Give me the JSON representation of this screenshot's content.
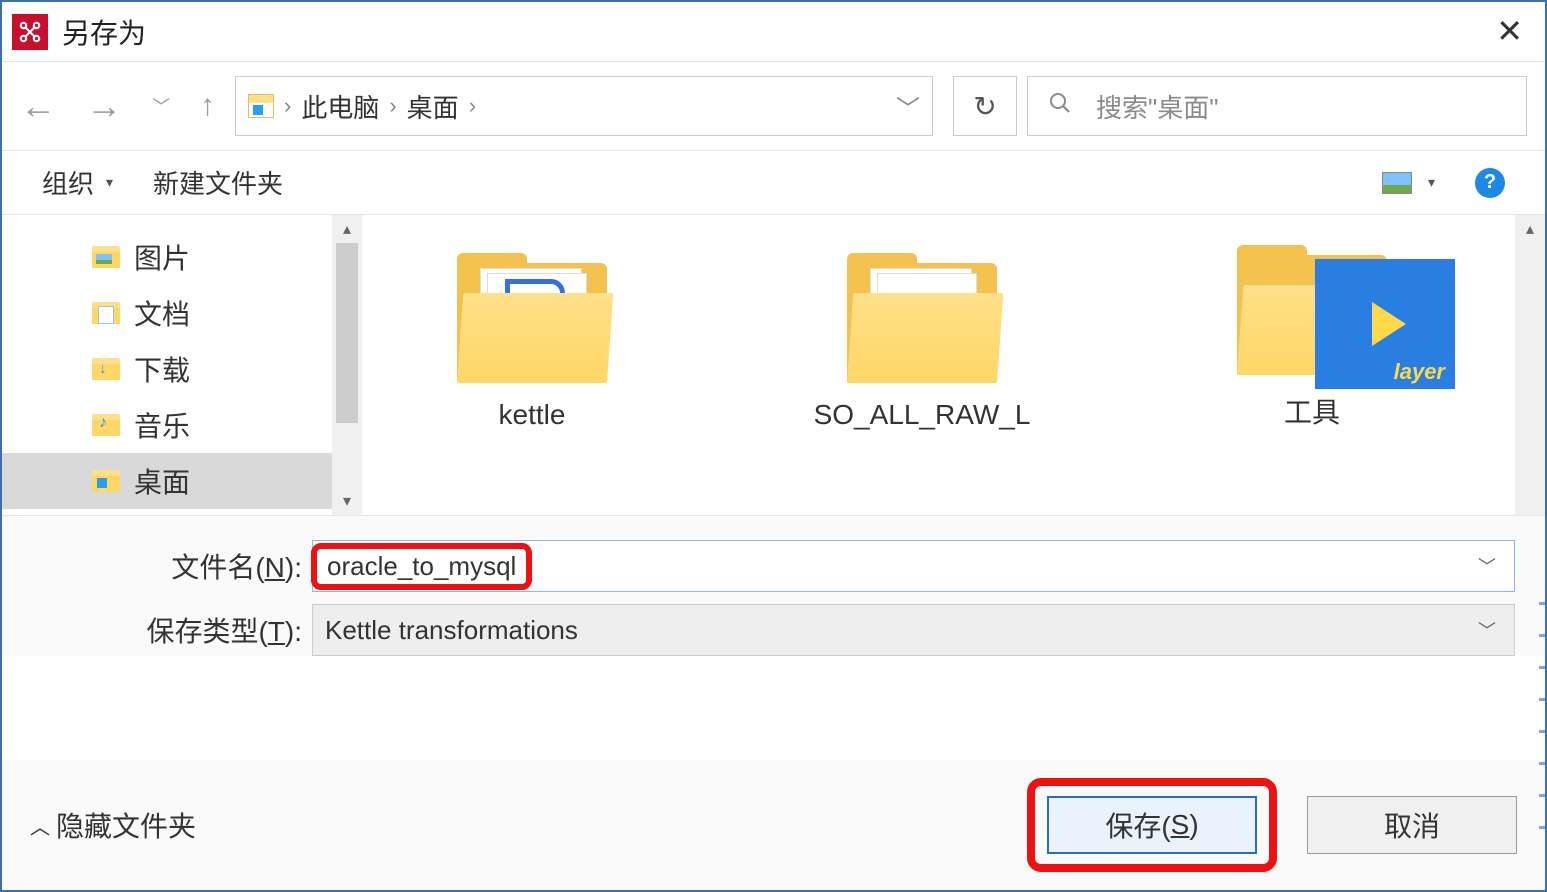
{
  "titlebar": {
    "title": "另存为"
  },
  "nav": {
    "breadcrumb": [
      "此电脑",
      "桌面"
    ],
    "search_placeholder": "搜索\"桌面\""
  },
  "toolbar": {
    "organize": "组织",
    "new_folder": "新建文件夹"
  },
  "sidebar": {
    "items": [
      {
        "label": "图片",
        "icon": "pic"
      },
      {
        "label": "文档",
        "icon": "doc"
      },
      {
        "label": "下载",
        "icon": "dl"
      },
      {
        "label": "音乐",
        "icon": "music"
      },
      {
        "label": "桌面",
        "icon": "desktop",
        "selected": true
      }
    ]
  },
  "content": {
    "items": [
      {
        "label": "kettle",
        "kind": "folder-doc"
      },
      {
        "label": "SO_ALL_RAW_L",
        "kind": "folder-text"
      },
      {
        "label": "工具",
        "kind": "folder-player"
      }
    ]
  },
  "form": {
    "filename_label": "文件名(N):",
    "filename_value": "oracle_to_mysql",
    "savetype_label": "保存类型(T):",
    "savetype_value": "Kettle transformations"
  },
  "footer": {
    "hide_folders": "隐藏文件夹",
    "save": "保存(S)",
    "cancel": "取消"
  }
}
